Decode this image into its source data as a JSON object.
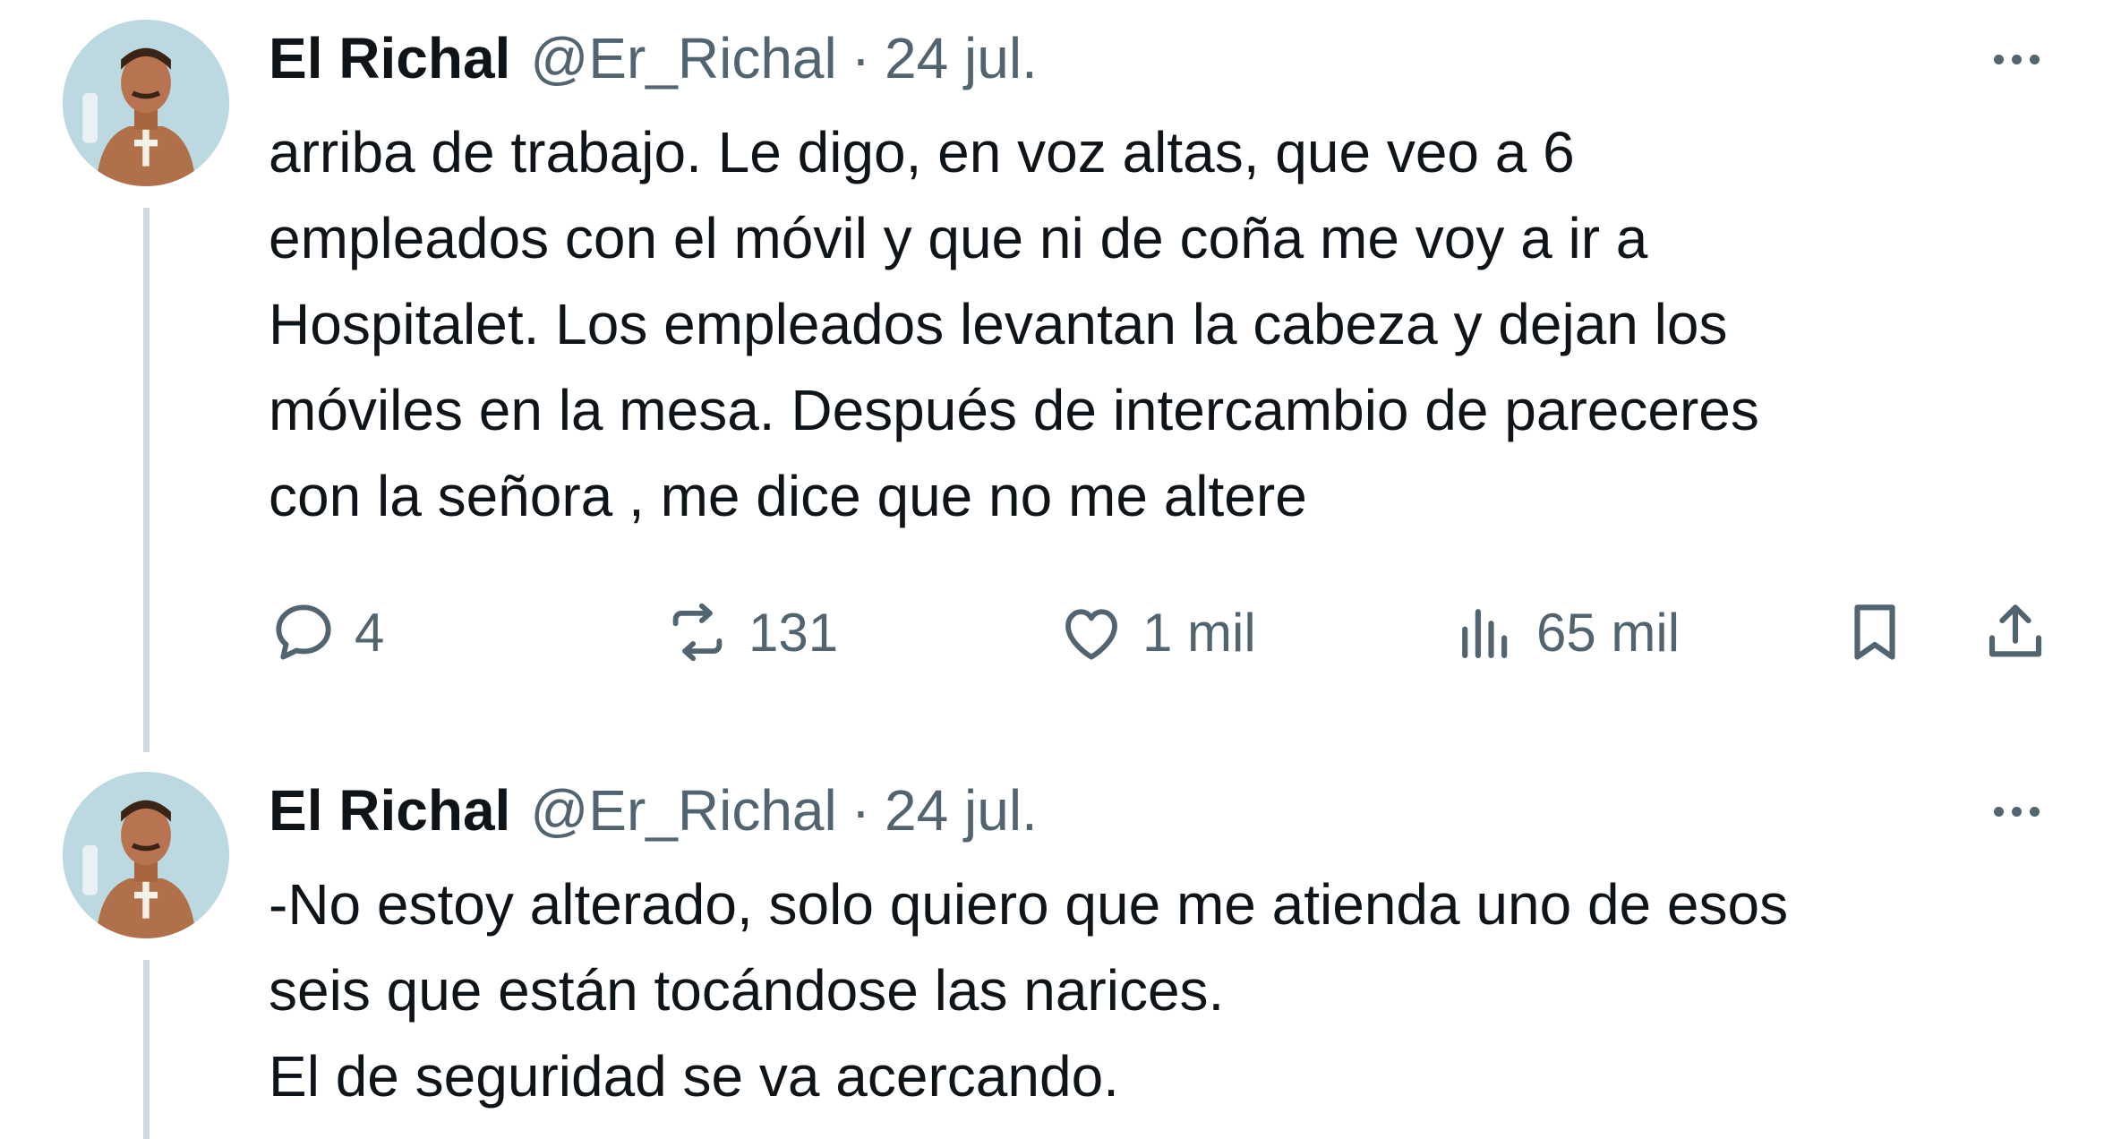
{
  "tweets": [
    {
      "author_name": "El Richal",
      "handle": "@Er_Richal",
      "separator": "·",
      "date": "24 jul.",
      "text_lines": [
        "arriba de trabajo. Le digo, en voz altas, que veo a 6",
        "empleados con el móvil y que ni de coña me voy a ir a",
        "Hospitalet. Los empleados levantan la cabeza y dejan los",
        "móviles en la mesa. Después de intercambio de pareceres",
        "con la señora , me dice que no me altere"
      ],
      "actions": {
        "replies": "4",
        "retweets": "131",
        "likes": "1 mil",
        "views": "65 mil"
      }
    },
    {
      "author_name": "El Richal",
      "handle": "@Er_Richal",
      "separator": "·",
      "date": "24 jul.",
      "text_lines": [
        "-No estoy alterado, solo quiero que me atienda uno de esos",
        "seis que están tocándose las narices.",
        "El de seguridad se va acercando."
      ]
    }
  ],
  "icons": {
    "more": "more-horizontal-icon",
    "reply": "reply-bubble-icon",
    "retweet": "retweet-arrows-icon",
    "like": "heart-icon",
    "views": "views-bars-icon",
    "bookmark": "bookmark-icon",
    "share": "share-upload-icon"
  },
  "colors": {
    "text_primary": "#0f1419",
    "text_secondary": "#536471",
    "thread_line": "#cfd9de",
    "background": "#ffffff"
  }
}
